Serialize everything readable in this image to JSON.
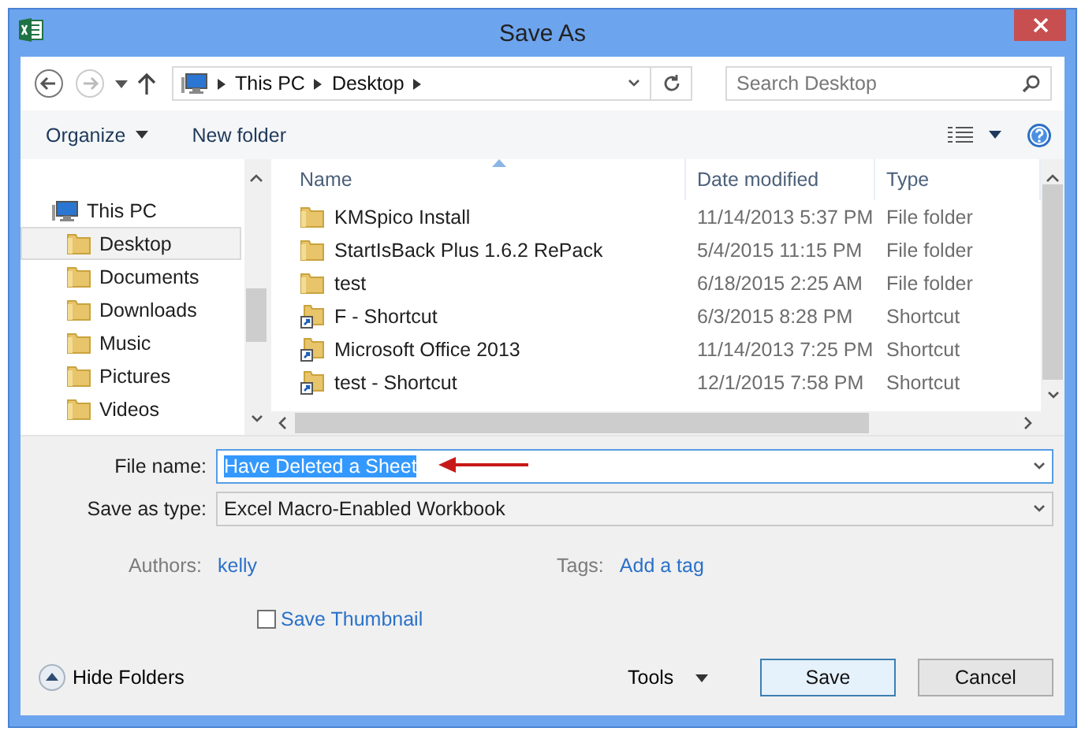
{
  "window": {
    "title": "Save As"
  },
  "address": {
    "crumbs": [
      "This PC",
      "Desktop"
    ]
  },
  "search": {
    "placeholder": "Search Desktop"
  },
  "toolbar": {
    "buttons": [
      "Organize",
      "New folder"
    ]
  },
  "nav": [
    {
      "label": "This PC",
      "kind": "computer",
      "selected": false,
      "children": [
        {
          "label": "Desktop",
          "kind": "folder",
          "selected": true
        },
        {
          "label": "Documents",
          "kind": "folder",
          "selected": false
        },
        {
          "label": "Downloads",
          "kind": "folder",
          "selected": false
        },
        {
          "label": "Music",
          "kind": "folder",
          "selected": false
        },
        {
          "label": "Pictures",
          "kind": "folder",
          "selected": false
        },
        {
          "label": "Videos",
          "kind": "folder",
          "selected": false
        }
      ]
    }
  ],
  "columns": [
    {
      "label": "Name",
      "sorted": true
    },
    {
      "label": "Date modified",
      "sorted": false
    },
    {
      "label": "Type",
      "sorted": false
    }
  ],
  "files": [
    {
      "name": "KMSpico Install",
      "date": "11/14/2013 5:37 PM",
      "type": "File folder",
      "kind": "folder"
    },
    {
      "name": "StartIsBack Plus 1.6.2 RePack",
      "date": "5/4/2015 11:15 PM",
      "type": "File folder",
      "kind": "folder"
    },
    {
      "name": "test",
      "date": "6/18/2015 2:25 AM",
      "type": "File folder",
      "kind": "folder"
    },
    {
      "name": "F - Shortcut",
      "date": "6/3/2015 8:28 PM",
      "type": "Shortcut",
      "kind": "shortcut"
    },
    {
      "name": "Microsoft Office 2013",
      "date": "11/14/2013 7:25 PM",
      "type": "Shortcut",
      "kind": "shortcut"
    },
    {
      "name": "test - Shortcut",
      "date": "12/1/2015 7:58 PM",
      "type": "Shortcut",
      "kind": "shortcut"
    }
  ],
  "file_name": {
    "label": "File name:",
    "value": "Have Deleted a Sheet",
    "text_selected": true
  },
  "save_as_type": {
    "label": "Save as type:",
    "value": "Excel Macro-Enabled Workbook"
  },
  "authors": {
    "label": "Authors:",
    "value": "kelly"
  },
  "tags": {
    "label": "Tags:",
    "value": "Add a tag"
  },
  "save_thumbnail": {
    "label": "Save Thumbnail",
    "checked": false
  },
  "hide_folders": "Hide Folders",
  "buttons": [
    {
      "label": "Tools",
      "kind": "menu"
    },
    {
      "label": "Save",
      "kind": "default"
    },
    {
      "label": "Cancel",
      "kind": "normal"
    }
  ]
}
